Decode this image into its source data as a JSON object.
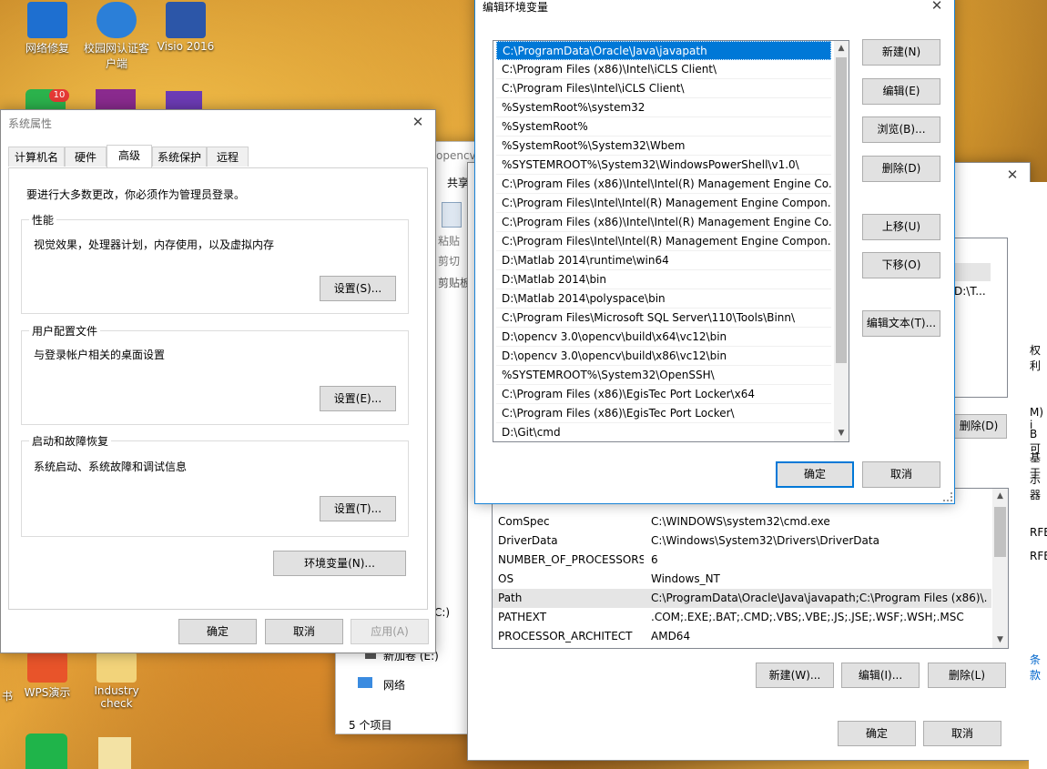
{
  "desktop": {
    "icons": [
      {
        "label": "网络修复"
      },
      {
        "label": "校园网认证客户端"
      },
      {
        "label": "Visio 2016"
      },
      {
        "label": "WPS演示"
      },
      {
        "label": "Industry check"
      },
      {
        "label": "书"
      },
      {
        "badge": "10"
      }
    ]
  },
  "explorer_bg": {
    "breadcrumb": "opencv",
    "ribbon_tab": "共享",
    "paste": "粘贴",
    "cut": "剪切",
    "clipboard": "剪贴板",
    "drive_item": "新加卷 (E:)",
    "network_item": "网络",
    "status": "5 个项目",
    "drive_c_fragment": "C:)"
  },
  "sysprops": {
    "title": "系统属性",
    "tabs": [
      "计算机名",
      "硬件",
      "高级",
      "系统保护",
      "远程"
    ],
    "active_tab": 2,
    "admin_note": "要进行大多数更改，你必须作为管理员登录。",
    "perf": {
      "legend": "性能",
      "desc": "视觉效果，处理器计划，内存使用，以及虚拟内存",
      "btn": "设置(S)..."
    },
    "profile": {
      "legend": "用户配置文件",
      "desc": "与登录帐户相关的桌面设置",
      "btn": "设置(E)..."
    },
    "startup": {
      "legend": "启动和故障恢复",
      "desc": "系统启动、系统故障和调试信息",
      "btn": "设置(T)..."
    },
    "env_btn": "环境变量(N)...",
    "ok": "确定",
    "cancel": "取消",
    "apply": "应用(A)"
  },
  "envvars": {
    "user_fragment": "D:\\T...",
    "delete_user_btn_fragment": "删除(D)",
    "system_vars": [
      {
        "name": "ComSpec",
        "value": "C:\\WINDOWS\\system32\\cmd.exe"
      },
      {
        "name": "DriverData",
        "value": "C:\\Windows\\System32\\Drivers\\DriverData"
      },
      {
        "name": "NUMBER_OF_PROCESSORS",
        "value": "6"
      },
      {
        "name": "OS",
        "value": "Windows_NT"
      },
      {
        "name": "Path",
        "value": "C:\\ProgramData\\Oracle\\Java\\javapath;C:\\Program Files (x86)\\..."
      },
      {
        "name": "PATHEXT",
        "value": ".COM;.EXE;.BAT;.CMD;.VBS;.VBE;.JS;.JSE;.WSF;.WSH;.MSC"
      },
      {
        "name": "PROCESSOR_ARCHITECT",
        "value": "AMD64"
      }
    ],
    "new_btn": "新建(W)...",
    "edit_btn": "编辑(I)...",
    "delete_btn": "删除(L)",
    "ok": "确定",
    "cancel": "取消",
    "side_fragments": [
      "权利",
      "M) i",
      "B 可",
      "基于",
      "示器",
      "RFE",
      "RFE",
      "条款"
    ]
  },
  "editenv": {
    "title": "编辑环境变量",
    "paths": [
      "C:\\ProgramData\\Oracle\\Java\\javapath",
      "C:\\Program Files (x86)\\Intel\\iCLS Client\\",
      "C:\\Program Files\\Intel\\iCLS Client\\",
      "%SystemRoot%\\system32",
      "%SystemRoot%",
      "%SystemRoot%\\System32\\Wbem",
      "%SYSTEMROOT%\\System32\\WindowsPowerShell\\v1.0\\",
      "C:\\Program Files (x86)\\Intel\\Intel(R) Management Engine Co...",
      "C:\\Program Files\\Intel\\Intel(R) Management Engine Compon...",
      "C:\\Program Files (x86)\\Intel\\Intel(R) Management Engine Co...",
      "C:\\Program Files\\Intel\\Intel(R) Management Engine Compon...",
      "D:\\Matlab 2014\\runtime\\win64",
      "D:\\Matlab 2014\\bin",
      "D:\\Matlab 2014\\polyspace\\bin",
      "C:\\Program Files\\Microsoft SQL Server\\110\\Tools\\Binn\\",
      "D:\\opencv 3.0\\opencv\\build\\x64\\vc12\\bin",
      "D:\\opencv 3.0\\opencv\\build\\x86\\vc12\\bin",
      "%SYSTEMROOT%\\System32\\OpenSSH\\",
      "C:\\Program Files (x86)\\EgisTec Port Locker\\x64",
      "C:\\Program Files (x86)\\EgisTec Port Locker\\",
      "D:\\Git\\cmd"
    ],
    "selected_index": 0,
    "new": "新建(N)",
    "edit": "编辑(E)",
    "browse": "浏览(B)...",
    "delete": "删除(D)",
    "move_up": "上移(U)",
    "move_down": "下移(O)",
    "edit_text": "编辑文本(T)...",
    "ok": "确定",
    "cancel": "取消"
  }
}
